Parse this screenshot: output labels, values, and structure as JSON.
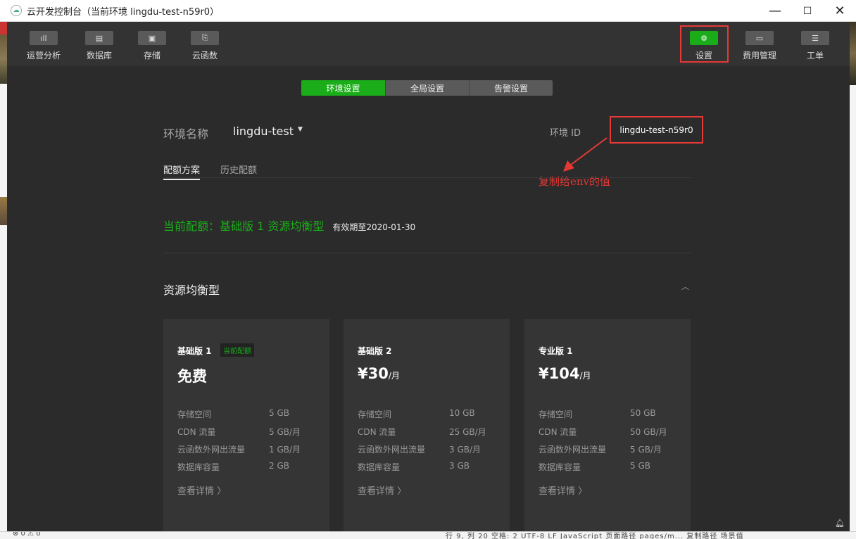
{
  "window": {
    "title": "云开发控制台（当前环境 lingdu-test-n59r0）",
    "min_label": "—",
    "max_label": "☐",
    "close_label": "✕"
  },
  "nav": {
    "items": [
      {
        "label": "运营分析",
        "icon": "bar-chart-icon",
        "glyph": "ıll"
      },
      {
        "label": "数据库",
        "icon": "database-icon",
        "glyph": "▤"
      },
      {
        "label": "存储",
        "icon": "save-icon",
        "glyph": "▣"
      },
      {
        "label": "云函数",
        "icon": "function-icon",
        "glyph": "⎘"
      }
    ],
    "right_items": [
      {
        "label": "设置",
        "icon": "gear-icon",
        "glyph": "⚙",
        "active": true
      },
      {
        "label": "费用管理",
        "icon": "billing-icon",
        "glyph": "▭"
      },
      {
        "label": "工单",
        "icon": "ticket-icon",
        "glyph": "☰"
      }
    ]
  },
  "tabs": {
    "items": [
      "环境设置",
      "全局设置",
      "告警设置"
    ],
    "active_index": 0
  },
  "env": {
    "name_label": "环境名称",
    "name_value": "lingdu-test",
    "caret": "▼",
    "id_label": "环境 ID",
    "id_value": "lingdu-test-n59r0"
  },
  "annotation": {
    "text": "复制给env的值"
  },
  "subtabs": {
    "items": [
      "配额方案",
      "历史配额"
    ],
    "active_index": 0
  },
  "plan": {
    "current_text": "当前配额：基础版 1 资源均衡型",
    "valid_text": "有效期至2020-01-30"
  },
  "section": {
    "title": "资源均衡型",
    "chevron": "︿"
  },
  "cards": [
    {
      "name": "基础版 1",
      "badge": "当前配额",
      "price": "免费",
      "unit": "",
      "rows": [
        {
          "label": "存储空间",
          "value": "5 GB"
        },
        {
          "label": "CDN 流量",
          "value": "5 GB/月"
        },
        {
          "label": "云函数外网出流量",
          "value": "1 GB/月"
        },
        {
          "label": "数据库容量",
          "value": "2 GB"
        }
      ],
      "detail": "查看详情 〉"
    },
    {
      "name": "基础版 2",
      "badge": "",
      "price": "¥30",
      "unit": "/月",
      "rows": [
        {
          "label": "存储空间",
          "value": "10 GB"
        },
        {
          "label": "CDN 流量",
          "value": "25 GB/月"
        },
        {
          "label": "云函数外网出流量",
          "value": "3 GB/月"
        },
        {
          "label": "数据库容量",
          "value": "3 GB"
        }
      ],
      "detail": "查看详情 〉"
    },
    {
      "name": "专业版 1",
      "badge": "",
      "price": "¥104",
      "unit": "/月",
      "rows": [
        {
          "label": "存储空间",
          "value": "50 GB"
        },
        {
          "label": "CDN 流量",
          "value": "50 GB/月"
        },
        {
          "label": "云函数外网出流量",
          "value": "5 GB/月"
        },
        {
          "label": "数据库容量",
          "value": "5 GB"
        }
      ],
      "detail": "查看详情 〉"
    }
  ],
  "statusbar": {
    "left": "⊗ 0 ⚠ 0",
    "right": "行 9, 列 20   空格: 2   UTF-8   LF   JavaScript   页面路径   pages/m...   复制路径   场景值"
  },
  "colors": {
    "accent": "#1aad19",
    "highlight": "#e53935",
    "background": "#2b2b2b",
    "card": "#353535"
  }
}
